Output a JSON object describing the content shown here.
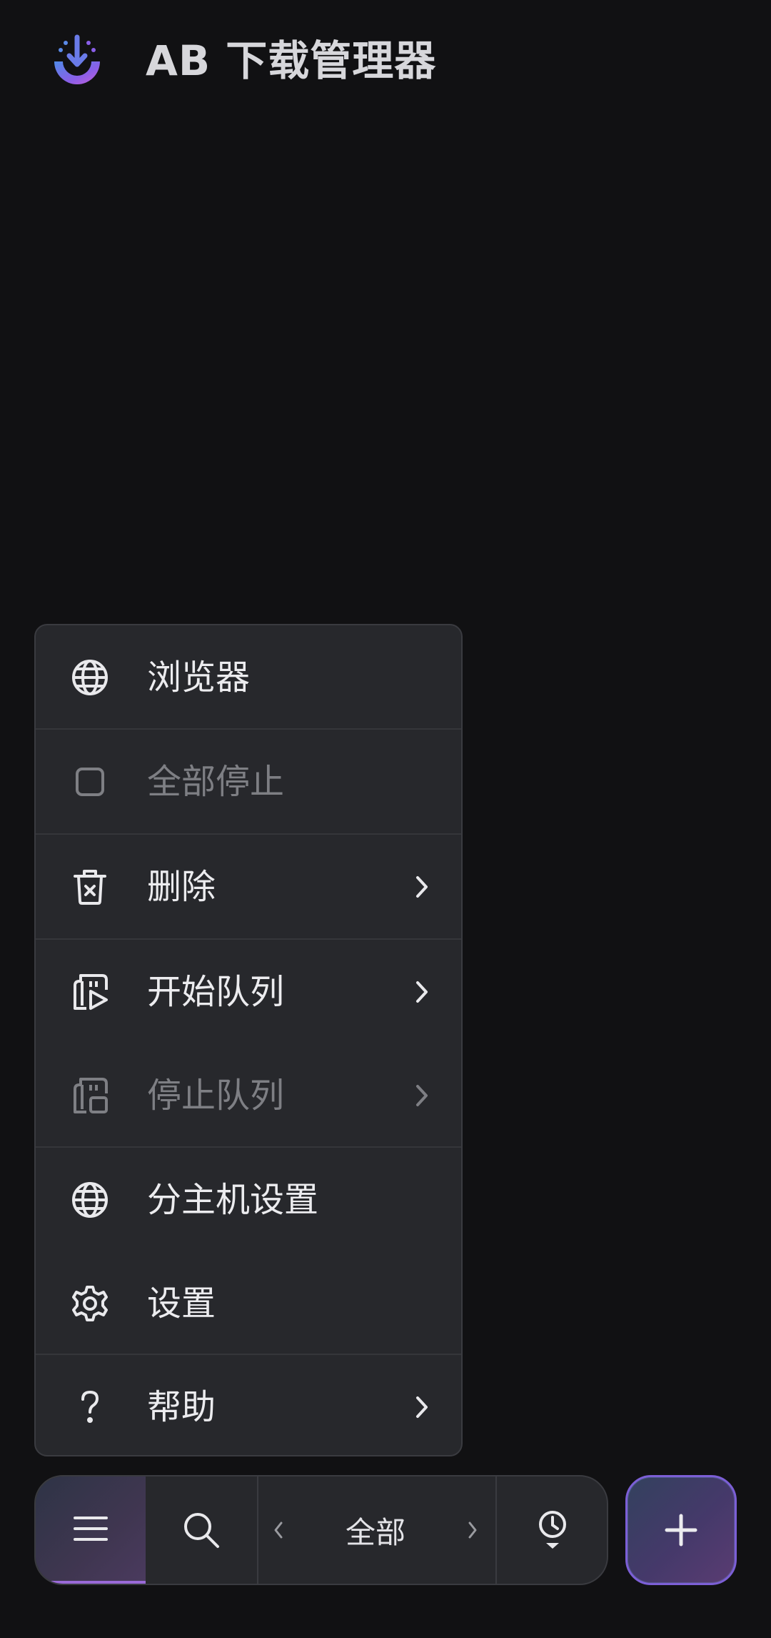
{
  "header": {
    "title": "AB 下载管理器",
    "logo": "download-logo-icon"
  },
  "menu": {
    "items": [
      {
        "label": "浏览器",
        "icon": "globe-icon",
        "disabled": false,
        "submenu": false
      },
      {
        "label": "全部停止",
        "icon": "stop-square-icon",
        "disabled": true,
        "submenu": false
      },
      {
        "label": "删除",
        "icon": "trash-icon",
        "disabled": false,
        "submenu": true
      },
      {
        "label": "开始队列",
        "icon": "queue-start-icon",
        "disabled": false,
        "submenu": true
      },
      {
        "label": "停止队列",
        "icon": "queue-stop-icon",
        "disabled": true,
        "submenu": true
      },
      {
        "label": "分主机设置",
        "icon": "globe-icon",
        "disabled": false,
        "submenu": false
      },
      {
        "label": "设置",
        "icon": "gear-icon",
        "disabled": false,
        "submenu": false
      },
      {
        "label": "帮助",
        "icon": "question-icon",
        "disabled": false,
        "submenu": true
      }
    ]
  },
  "bottom_bar": {
    "filter_label": "全部",
    "buttons": [
      "menu-icon",
      "search-icon",
      "chevron-left-icon",
      "chevron-right-icon",
      "schedule-clock-icon",
      "plus-icon"
    ]
  },
  "colors": {
    "background": "#111113",
    "surface": "#27282c",
    "text": "#ececef",
    "disabled_text": "#7e7f84",
    "accent_purple": "#9a6ad8",
    "accent_blue": "#4f8ae8"
  }
}
